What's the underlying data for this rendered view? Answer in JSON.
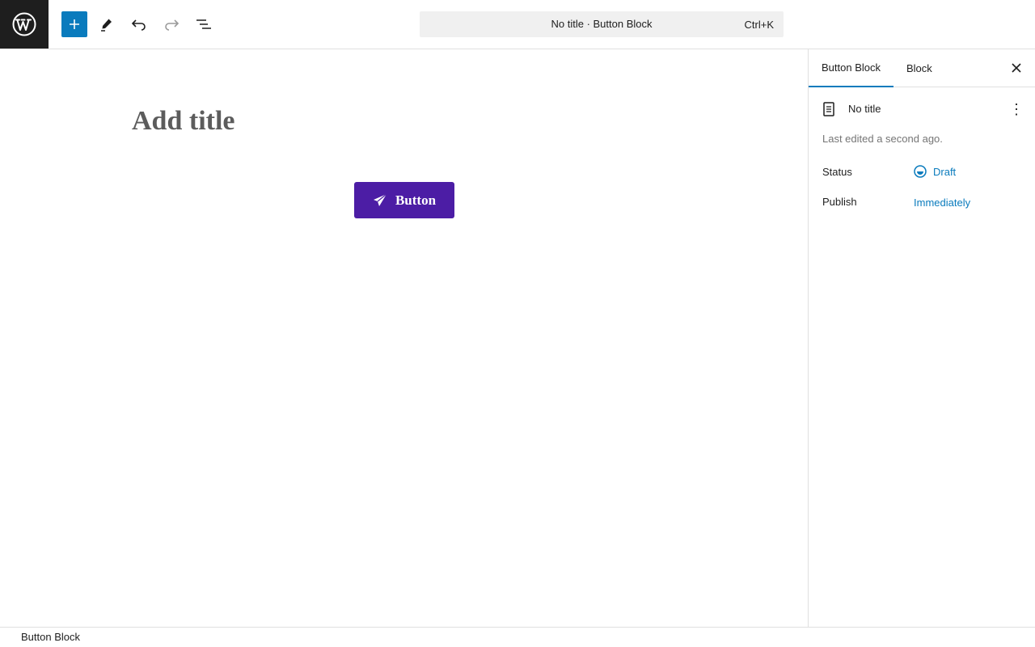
{
  "toolbar": {
    "logo_icon": "wordpress-logo-icon",
    "add_icon": "plus-icon",
    "edit_icon": "pencil-icon",
    "undo_icon": "undo-icon",
    "redo_icon": "redo-icon",
    "list_icon": "document-overview-icon"
  },
  "command": {
    "title": "No title · Button Block",
    "shortcut": "Ctrl+K"
  },
  "editor": {
    "title_placeholder": "Add title",
    "button_label": "Button",
    "button_icon": "paper-plane-icon",
    "button_color": "#4c1da5"
  },
  "sidebar": {
    "tabs": [
      {
        "label": "Button Block",
        "active": true
      },
      {
        "label": "Block",
        "active": false
      }
    ],
    "document_title": "No title",
    "last_edited": "Last edited a second ago.",
    "status_label": "Status",
    "status_value": "Draft",
    "publish_label": "Publish",
    "publish_value": "Immediately",
    "accent_color": "#0a7bbd"
  },
  "footer": {
    "breadcrumb": "Button Block"
  }
}
